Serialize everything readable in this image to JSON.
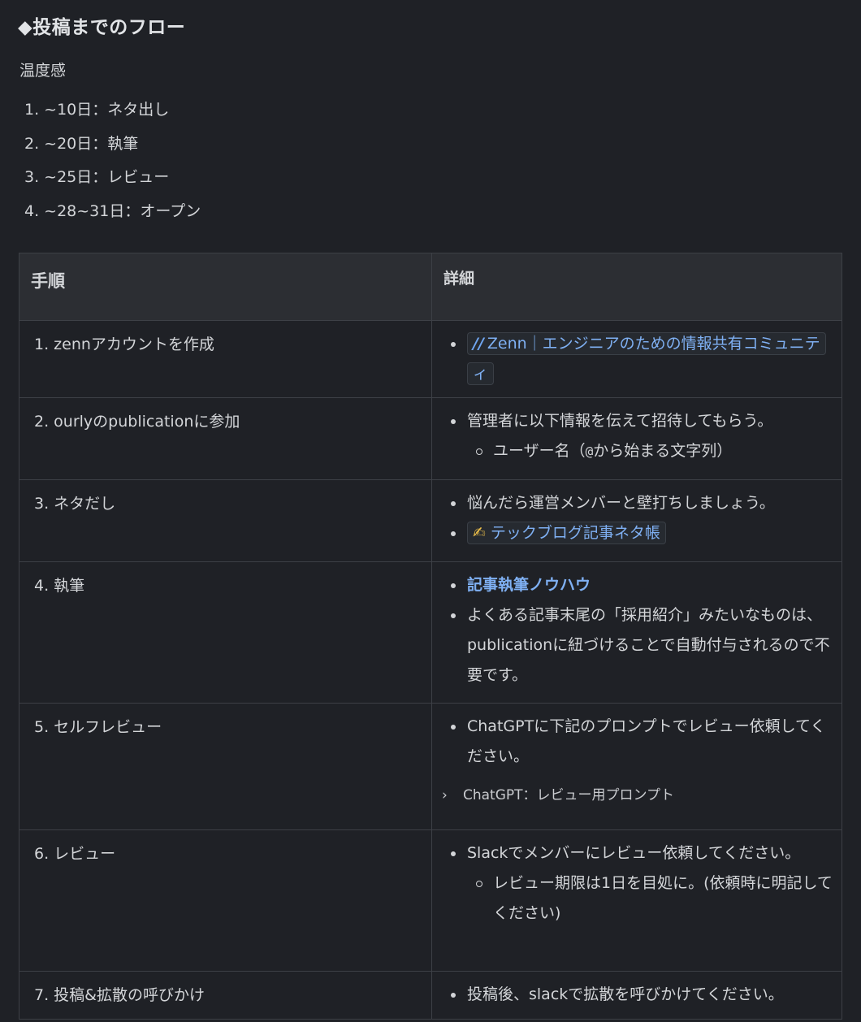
{
  "heading": "◆投稿までのフロー",
  "lead": "温度感",
  "timeline": [
    "1. ~10日：ネタ出し",
    "2. ~20日：執筆",
    "3. ~25日：レビュー",
    "4. ~28~31日：オープン"
  ],
  "table": {
    "headers": [
      "手順",
      "詳細"
    ],
    "rows": [
      {
        "step": "1. zennアカウントを作成",
        "link_icon": "zenn-logo-icon",
        "link": "Zenn｜エンジニアのための情報共有コミュニティ"
      },
      {
        "step": "2. ourlyのpublicationに参加",
        "bullet": "管理者に以下情報を伝えて招待してもらう。",
        "sub_prefix": "ユーザー名（",
        "sub_mono": "@",
        "sub_suffix": "から始まる文字列）"
      },
      {
        "step": "3. ネタだし",
        "bullet": "悩んだら運営メンバーと壁打ちしましょう。",
        "link_icon": "writing-hand-icon",
        "link_emoji": "✍",
        "link": "テックブログ記事ネタ帳"
      },
      {
        "step": "4. 執筆",
        "link": "記事執筆ノウハウ",
        "bullet": "よくある記事末尾の「採用紹介」みたいなものは、publicationに紐づけることで自動付与されるので不要です。"
      },
      {
        "step": "5. セルフレビュー",
        "bullet": "ChatGPTに下記のプロンプトでレビュー依頼してください。",
        "toggle": "ChatGPT：レビュー用プロンプト"
      },
      {
        "step": "6. レビュー",
        "bullet": "Slackでメンバーにレビュー依頼してください。",
        "sub": "レビュー期限は1日を目処に。(依頼時に明記してください)"
      },
      {
        "step": "7. 投稿&拡散の呼びかけ",
        "bullet": "投稿後、slackで拡散を呼びかけてください。"
      }
    ]
  }
}
